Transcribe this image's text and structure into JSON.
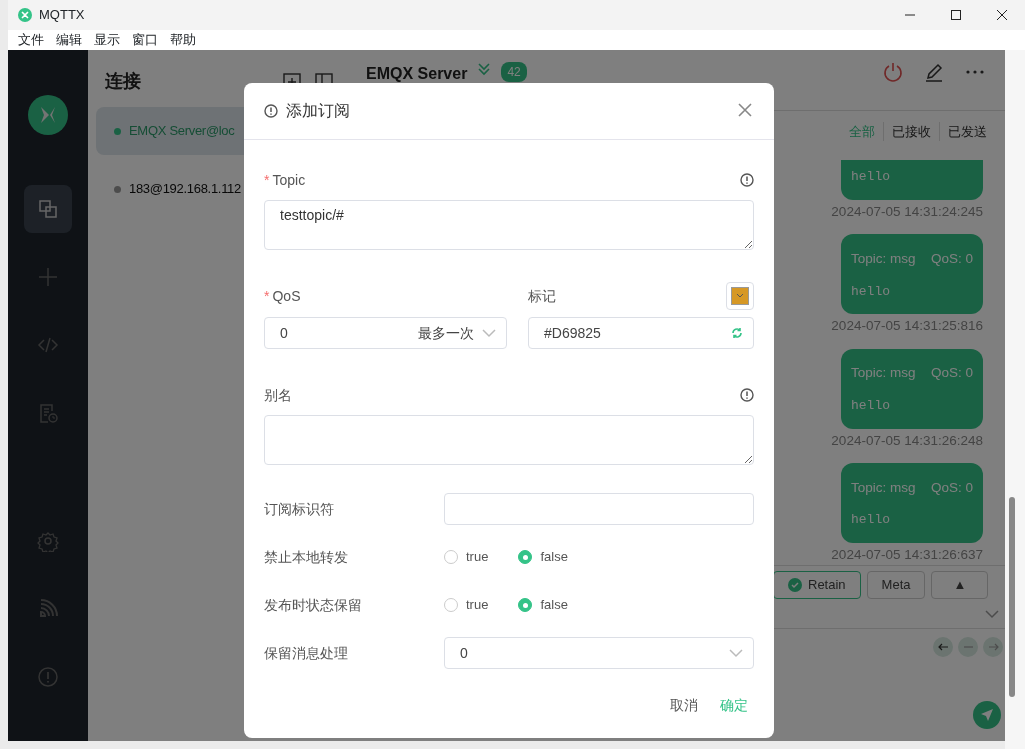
{
  "window": {
    "title": "MQTTX"
  },
  "menu": [
    "文件",
    "编辑",
    "显示",
    "窗口",
    "帮助"
  ],
  "nav": [
    {
      "kind": "connections",
      "selected": true
    },
    {
      "kind": "new",
      "selected": false
    },
    {
      "kind": "script",
      "selected": false
    },
    {
      "kind": "log",
      "selected": false
    },
    {
      "kind": "settings",
      "selected": false
    },
    {
      "kind": "feed",
      "selected": false
    },
    {
      "kind": "about",
      "selected": false
    }
  ],
  "connections": {
    "title": "连接",
    "items": [
      {
        "name": "EMQX Server@loc",
        "selected": true,
        "connected": true
      },
      {
        "name": "183@192.168.1.112",
        "selected": false,
        "connected": false
      }
    ]
  },
  "main": {
    "title": "EMQX Server",
    "count": "42",
    "filters": [
      {
        "label": "全部",
        "selected": true
      },
      {
        "label": "已接收",
        "selected": false
      },
      {
        "label": "已发送",
        "selected": false
      }
    ],
    "messages": [
      {
        "payload": "hello",
        "time": "2024-07-05 14:31:24:245"
      },
      {
        "topic": "Topic: msg",
        "qos": "QoS: 0",
        "payload": "hello",
        "time": "2024-07-05 14:31:25:816"
      },
      {
        "topic": "Topic: msg",
        "qos": "QoS: 0",
        "payload": "hello",
        "time": "2024-07-05 14:31:26:248"
      },
      {
        "topic": "Topic: msg",
        "qos": "QoS: 0",
        "payload": "hello",
        "time": "2024-07-05 14:31:26:637"
      }
    ],
    "retain": {
      "label": "Retain",
      "checked": true
    },
    "meta": "Meta",
    "expand": "▲"
  },
  "dialog": {
    "title": "添加订阅",
    "topic": {
      "label": "Topic",
      "required_mark": "*",
      "value": "testtopic/#"
    },
    "qos": {
      "label": "QoS",
      "required_mark": "*",
      "value": "0",
      "hint": "最多一次"
    },
    "mark": {
      "label": "标记",
      "value": "#D69825",
      "color": "#d69825"
    },
    "alias": {
      "label": "别名"
    },
    "subscription_id": {
      "label": "订阅标识符"
    },
    "radios": [
      {
        "label": "禁止本地转发",
        "options": [
          {
            "label": "true",
            "selected": false
          },
          {
            "label": "false",
            "selected": true
          }
        ]
      },
      {
        "label": "发布时状态保留",
        "options": [
          {
            "label": "true",
            "selected": false
          },
          {
            "label": "false",
            "selected": true
          }
        ]
      }
    ],
    "retain_handling": {
      "label": "保留消息处理",
      "value": "0"
    },
    "cancel": "取消",
    "ok": "确定"
  }
}
